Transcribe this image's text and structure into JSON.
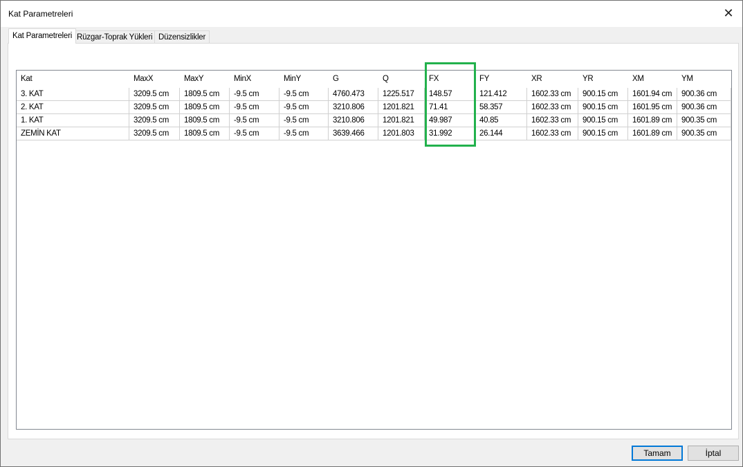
{
  "window": {
    "title": "Kat Parametreleri",
    "close_icon": "close-icon"
  },
  "tabs": [
    {
      "label": "Kat Parametreleri",
      "active": true
    },
    {
      "label": "Rüzgar-Toprak Yükleri",
      "active": false
    },
    {
      "label": "Düzensizlikler",
      "active": false
    }
  ],
  "table": {
    "columns": [
      "Kat",
      "MaxX",
      "MaxY",
      "MinX",
      "MinY",
      "G",
      "Q",
      "FX",
      "FY",
      "XR",
      "YR",
      "XM",
      "YM"
    ],
    "rows": [
      [
        "3. KAT",
        "3209.5 cm",
        "1809.5 cm",
        "-9.5 cm",
        "-9.5 cm",
        "4760.473",
        "1225.517",
        "148.57",
        "121.412",
        "1602.33 cm",
        "900.15 cm",
        "1601.94 cm",
        "900.36 cm"
      ],
      [
        "2. KAT",
        "3209.5 cm",
        "1809.5 cm",
        "-9.5 cm",
        "-9.5 cm",
        "3210.806",
        "1201.821",
        "71.41",
        "58.357",
        "1602.33 cm",
        "900.15 cm",
        "1601.95 cm",
        "900.36 cm"
      ],
      [
        "1. KAT",
        "3209.5 cm",
        "1809.5 cm",
        "-9.5 cm",
        "-9.5 cm",
        "3210.806",
        "1201.821",
        "49.987",
        "40.85",
        "1602.33 cm",
        "900.15 cm",
        "1601.89 cm",
        "900.35 cm"
      ],
      [
        "ZEMİN KAT",
        "3209.5 cm",
        "1809.5 cm",
        "-9.5 cm",
        "-9.5 cm",
        "3639.466",
        "1201.803",
        "31.992",
        "26.144",
        "1602.33 cm",
        "900.15 cm",
        "1601.89 cm",
        "900.35 cm"
      ]
    ],
    "highlighted_column": "FX",
    "highlight_color": "#22b14c"
  },
  "buttons": {
    "ok": "Tamam",
    "cancel": "İptal"
  }
}
